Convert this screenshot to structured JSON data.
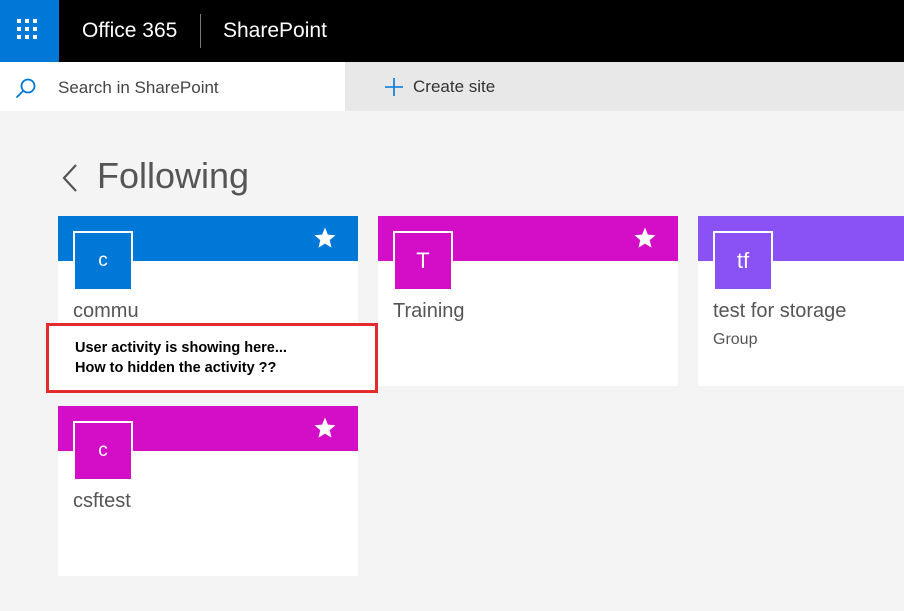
{
  "suite_bar": {
    "app_launcher_icon": "waffle-icon",
    "brand_primary": "Office 365",
    "brand_secondary": "SharePoint",
    "background": "#000000",
    "launcher_color": "#0078d7"
  },
  "search": {
    "icon": "search-icon",
    "placeholder": "Search in SharePoint"
  },
  "command_bar": {
    "create_site_icon": "plus-icon",
    "create_site_label": "Create site"
  },
  "page": {
    "back_icon": "chevron-left-icon",
    "title": "Following"
  },
  "sites": [
    {
      "logo_text": "c",
      "name": "commu",
      "type": "",
      "color": "#0078d7",
      "starred": true
    },
    {
      "logo_text": "T",
      "name": "Training",
      "type": "",
      "color": "#d40dc6",
      "starred": true
    },
    {
      "logo_text": "tf",
      "name": "test for storage",
      "type": "Group",
      "color": "#8a52f5",
      "starred": false
    },
    {
      "logo_text": "c",
      "name": "csftest",
      "type": "",
      "color": "#d40dc6",
      "starred": true
    }
  ],
  "annotation": {
    "line1": "User activity is showing here...",
    "line2": "How to hidden the activity ??",
    "border_color": "#e32b2b"
  }
}
